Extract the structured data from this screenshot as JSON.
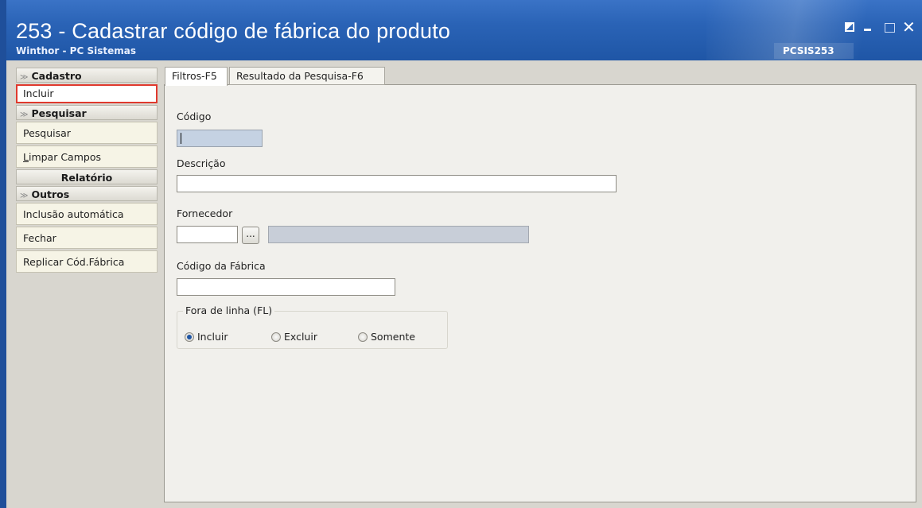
{
  "window": {
    "title": "253 - Cadastrar código de fábrica do produto",
    "subtitle": "Winthor - PC Sistemas",
    "code": "PCSIS253",
    "controls": {
      "restore_icon": "restore-icon",
      "minimize_label": "_",
      "maximize_icon": "maximize-icon",
      "close_label": "✕"
    }
  },
  "sidebar": {
    "sections": [
      {
        "title": "Cadastro",
        "items": [
          "Incluir"
        ]
      },
      {
        "title": "Pesquisar",
        "items": [
          "Pesquisar",
          "Limpar Campos"
        ]
      },
      {
        "title": "Relatório",
        "items": []
      },
      {
        "title": "Outros",
        "items": [
          "Inclusão automática",
          "Fechar",
          "Replicar Cód.Fábrica"
        ]
      }
    ]
  },
  "tabs": [
    "Filtros-F5",
    "Resultado da Pesquisa-F6"
  ],
  "form": {
    "codigo_label": "Código",
    "codigo_value": "",
    "descricao_label": "Descrição",
    "descricao_value": "",
    "fornecedor_label": "Fornecedor",
    "fornecedor_value": "",
    "fornecedor_button": "...",
    "fornecedor_name": "",
    "codigo_fabrica_label": "Código da Fábrica",
    "codigo_fabrica_value": "",
    "fora_linha": {
      "title": "Fora de linha (FL)",
      "options": [
        "Incluir",
        "Excluir",
        "Somente"
      ],
      "selected": "Incluir"
    }
  }
}
